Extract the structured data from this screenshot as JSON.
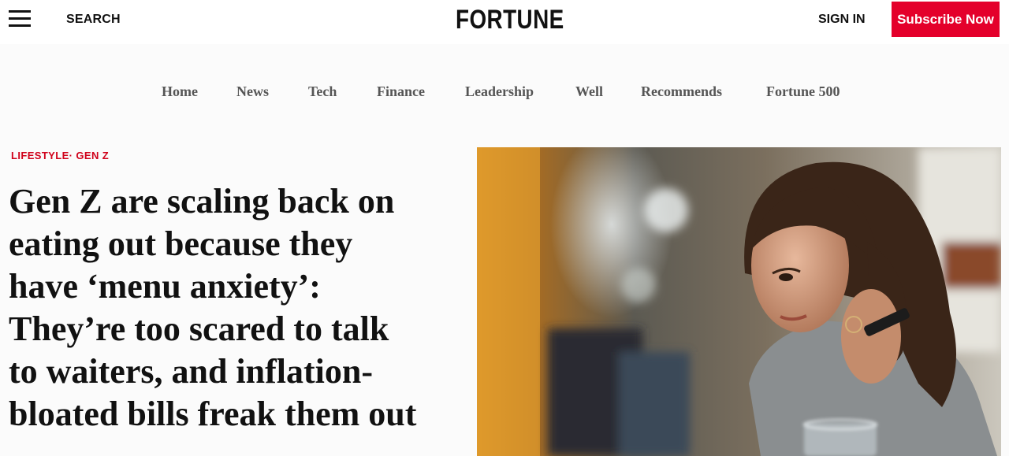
{
  "header": {
    "menu_icon": "hamburger-menu-icon",
    "search_label": "SEARCH",
    "logo": "FORTUNE",
    "sign_in_label": "SIGN IN",
    "subscribe_label": "Subscribe Now",
    "subscribe_color": "#e4002b"
  },
  "nav": {
    "items": [
      "Home",
      "News",
      "Tech",
      "Finance",
      "Leadership",
      "Well",
      "Recommends",
      "Fortune 500"
    ]
  },
  "article": {
    "kicker": "LIFESTYLE· GEN Z",
    "kicker_color": "#d0021b",
    "headline_lines": [
      "Gen Z are scaling back on",
      "eating out because they",
      "have ‘menu anxiety’:",
      "They’re too scared to talk",
      "to waiters, and inflation-",
      "bloated bills freak them out"
    ]
  }
}
